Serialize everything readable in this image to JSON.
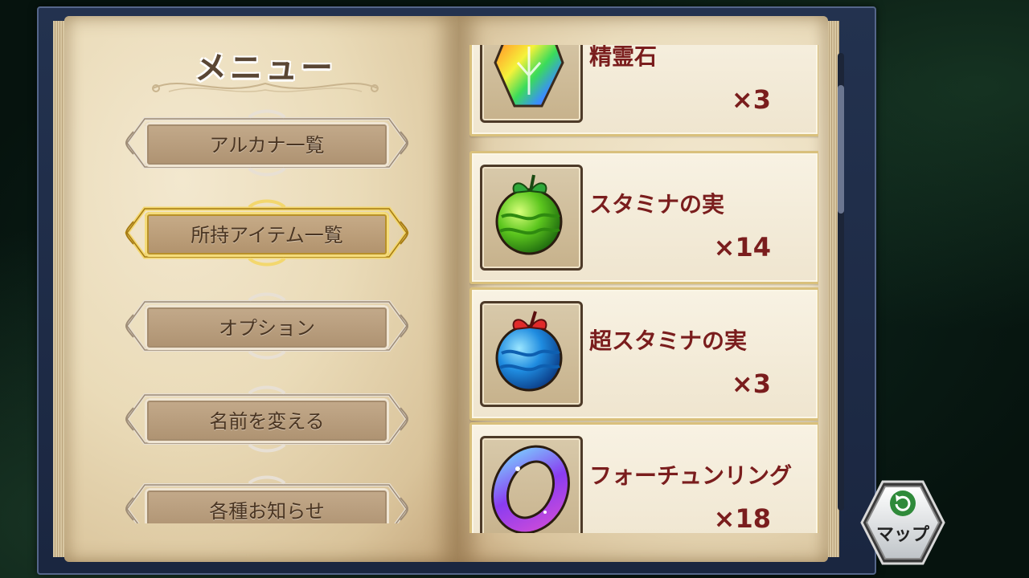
{
  "menu": {
    "title": "メニュー",
    "items": [
      {
        "label": "アルカナ一覧",
        "selected": false
      },
      {
        "label": "所持アイテム一覧",
        "selected": true
      },
      {
        "label": "オプション",
        "selected": false
      },
      {
        "label": "名前を変える",
        "selected": false
      },
      {
        "label": "各種お知らせ",
        "selected": false
      }
    ]
  },
  "items": [
    {
      "name": "精霊石",
      "count": "×3",
      "icon": "rainbow-crystal-icon"
    },
    {
      "name": "スタミナの実",
      "count": "×14",
      "icon": "green-fruit-icon"
    },
    {
      "name": "超スタミナの実",
      "count": "×3",
      "icon": "blue-fruit-icon"
    },
    {
      "name": "フォーチュンリング",
      "count": "×18",
      "icon": "purple-ring-icon"
    }
  ],
  "map_button": {
    "label": "マップ",
    "icon": "refresh-arrow-icon"
  },
  "colors": {
    "item_text": "#7a1d1d",
    "menu_text": "#4a3522",
    "selected_border": "#d9b640",
    "frame": "#23324f"
  }
}
